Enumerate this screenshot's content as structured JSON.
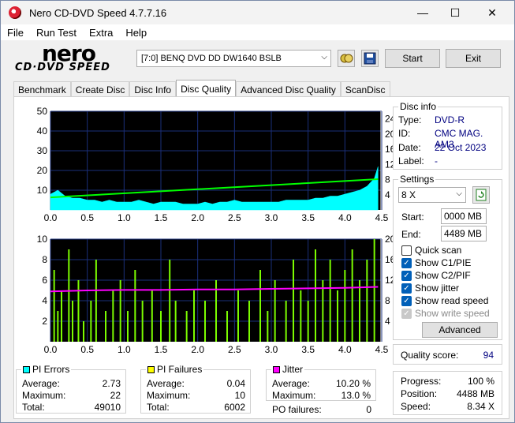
{
  "window": {
    "title": "Nero CD-DVD Speed 4.7.7.16",
    "minimize": "—",
    "maximize": "☐",
    "close": "✕"
  },
  "menu": [
    "File",
    "Run Test",
    "Extra",
    "Help"
  ],
  "toolbar": {
    "drive": "[7:0]   BENQ DVD DD DW1640 BSLB",
    "start_label": "Start",
    "exit_label": "Exit",
    "logo_top": "nero",
    "logo_bottom": "CD·DVD SPEED"
  },
  "tabs": [
    "Benchmark",
    "Create Disc",
    "Disc Info",
    "Disc Quality",
    "Advanced Disc Quality",
    "ScanDisc"
  ],
  "disc_info": {
    "title": "Disc info",
    "type_label": "Type:",
    "type": "DVD-R",
    "id_label": "ID:",
    "id": "CMC MAG. AM3",
    "date_label": "Date:",
    "date": "22 Oct 2023",
    "label_label": "Label:",
    "label": "-"
  },
  "settings": {
    "title": "Settings",
    "speed": "8 X",
    "start_label": "Start:",
    "start": "0000 MB",
    "end_label": "End:",
    "end": "4489 MB",
    "quick_scan": "Quick scan",
    "show_c1": "Show C1/PIE",
    "show_c2": "Show C2/PIF",
    "show_jitter": "Show jitter",
    "show_read": "Show read speed",
    "show_write": "Show write speed",
    "advanced_label": "Advanced"
  },
  "quality": {
    "label": "Quality score:",
    "score": "94"
  },
  "progress": {
    "progress_label": "Progress:",
    "progress": "100 %",
    "position_label": "Position:",
    "position": "4488 MB",
    "speed_label": "Speed:",
    "speed": "8.34 X"
  },
  "pi_errors": {
    "title": "PI Errors",
    "color": "#00ffff",
    "average_label": "Average:",
    "average": "2.73",
    "maximum_label": "Maximum:",
    "maximum": "22",
    "total_label": "Total:",
    "total": "49010"
  },
  "pi_failures": {
    "title": "PI Failures",
    "color": "#ffff00",
    "average_label": "Average:",
    "average": "0.04",
    "maximum_label": "Maximum:",
    "maximum": "10",
    "total_label": "Total:",
    "total": "6002"
  },
  "jitter": {
    "title": "Jitter",
    "color": "#ff00ff",
    "average_label": "Average:",
    "average": "10.20 %",
    "maximum_label": "Maximum:",
    "maximum": "13.0 %",
    "po_label": "PO failures:",
    "po": "0"
  },
  "chart_data": [
    {
      "type": "area",
      "x_ticks": [
        "0.0",
        "0.5",
        "1.0",
        "1.5",
        "2.0",
        "2.5",
        "3.0",
        "3.5",
        "4.0",
        "4.5"
      ],
      "y_left_ticks": [
        "10",
        "20",
        "30",
        "40",
        "50"
      ],
      "y_right_ticks": [
        "4",
        "8",
        "12",
        "16",
        "20",
        "24"
      ],
      "xlim": [
        0,
        4.5
      ],
      "ylim_left": [
        0,
        50
      ],
      "ylim_right": [
        0,
        26
      ],
      "series": [
        {
          "values_desc": "pi_errors",
          "color": "#00ffff",
          "x": [
            0.0,
            0.1,
            0.2,
            0.3,
            0.4,
            0.5,
            0.6,
            0.7,
            0.8,
            0.9,
            1.0,
            1.1,
            1.2,
            1.3,
            1.4,
            1.5,
            1.6,
            1.7,
            1.8,
            1.9,
            2.0,
            2.1,
            2.2,
            2.3,
            2.4,
            2.5,
            2.6,
            2.7,
            2.8,
            2.9,
            3.0,
            3.1,
            3.2,
            3.3,
            3.4,
            3.5,
            3.6,
            3.7,
            3.8,
            3.9,
            4.0,
            4.1,
            4.2,
            4.3,
            4.4,
            4.45
          ],
          "y": [
            8,
            10,
            7,
            6,
            6,
            5,
            5,
            4,
            5,
            4,
            4,
            4,
            5,
            4,
            3,
            4,
            4,
            4,
            3,
            3,
            3,
            4,
            3,
            4,
            4,
            5,
            4,
            4,
            4,
            4,
            4,
            4,
            5,
            5,
            5,
            5,
            6,
            6,
            7,
            7,
            8,
            9,
            10,
            12,
            16,
            22
          ]
        },
        {
          "values_desc": "read_speed",
          "color": "#00ff00",
          "x": [
            0.0,
            4.45
          ],
          "y": [
            3.3,
            8.1
          ]
        }
      ]
    },
    {
      "type": "bar",
      "x_ticks": [
        "0.0",
        "0.5",
        "1.0",
        "1.5",
        "2.0",
        "2.5",
        "3.0",
        "3.5",
        "4.0",
        "4.5"
      ],
      "y_left_ticks": [
        "2",
        "4",
        "6",
        "8",
        "10"
      ],
      "y_right_ticks": [
        "4",
        "8",
        "12",
        "16",
        "20"
      ],
      "xlim": [
        0,
        4.5
      ],
      "ylim_left": [
        0,
        10
      ],
      "ylim_right": [
        0,
        20
      ],
      "series": [
        {
          "values_desc": "pi_failures",
          "color": "#7cfc00",
          "x": [
            0.05,
            0.1,
            0.15,
            0.25,
            0.3,
            0.38,
            0.45,
            0.55,
            0.62,
            0.75,
            0.85,
            0.95,
            1.05,
            1.15,
            1.25,
            1.38,
            1.5,
            1.62,
            1.7,
            1.85,
            1.95,
            2.1,
            2.25,
            2.4,
            2.55,
            2.7,
            2.85,
            2.95,
            3.05,
            3.2,
            3.3,
            3.4,
            3.5,
            3.6,
            3.7,
            3.8,
            3.9,
            4.0,
            4.1,
            4.2,
            4.3,
            4.4
          ],
          "y": [
            7,
            3,
            5,
            9,
            4,
            6,
            2,
            4,
            8,
            3,
            5,
            6,
            3,
            7,
            4,
            5,
            3,
            8,
            4,
            3,
            5,
            4,
            6,
            3,
            5,
            4,
            7,
            3,
            6,
            4,
            8,
            5,
            4,
            9,
            6,
            8,
            5,
            7,
            9,
            6,
            8,
            10
          ]
        },
        {
          "values_desc": "jitter",
          "color": "#ff00ff",
          "x": [
            0.0,
            0.5,
            1.0,
            1.5,
            2.0,
            2.5,
            3.0,
            3.5,
            4.0,
            4.45
          ],
          "y": [
            9.8,
            10.0,
            10.1,
            10.1,
            10.2,
            10.2,
            10.3,
            10.4,
            10.5,
            10.7
          ]
        }
      ]
    }
  ]
}
